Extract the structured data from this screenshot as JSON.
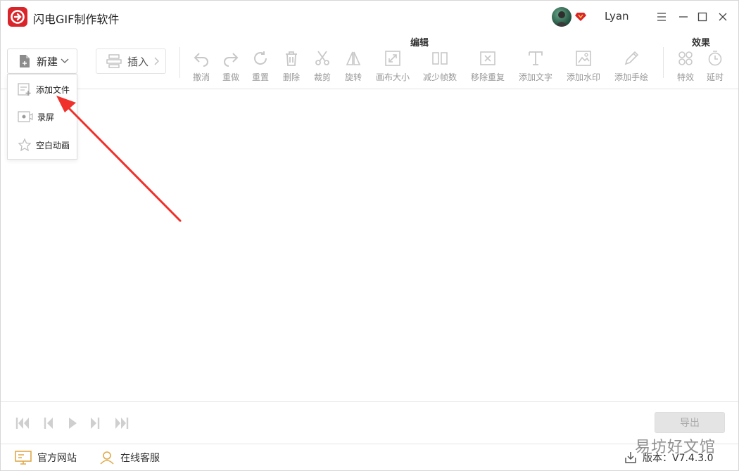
{
  "app": {
    "title": "闪电GIF制作软件",
    "username": "Lyan",
    "brand_color": "#d9242a"
  },
  "toolbar": {
    "new_label": "新建",
    "insert_label": "插入",
    "group_edit_label": "编辑",
    "group_effect_label": "效果",
    "tools": [
      {
        "label": "撤消",
        "icon": "undo-icon"
      },
      {
        "label": "重做",
        "icon": "redo-icon"
      },
      {
        "label": "重置",
        "icon": "reset-icon"
      },
      {
        "label": "删除",
        "icon": "delete-icon"
      },
      {
        "label": "裁剪",
        "icon": "scissors-icon"
      },
      {
        "label": "旋转",
        "icon": "rotate-icon"
      },
      {
        "label": "画布大小",
        "icon": "canvas-size-icon"
      },
      {
        "label": "减少帧数",
        "icon": "reduce-frames-icon"
      },
      {
        "label": "移除重复",
        "icon": "remove-duplicate-icon"
      },
      {
        "label": "添加文字",
        "icon": "add-text-icon"
      },
      {
        "label": "添加水印",
        "icon": "add-watermark-icon"
      },
      {
        "label": "添加手绘",
        "icon": "add-drawing-icon"
      },
      {
        "label": "特效",
        "icon": "effects-icon"
      },
      {
        "label": "延时",
        "icon": "delay-icon"
      }
    ]
  },
  "new_menu": {
    "items": [
      {
        "label": "添加文件",
        "icon": "add-file-icon"
      },
      {
        "label": "录屏",
        "icon": "screen-record-icon"
      },
      {
        "label": "空白动画",
        "icon": "blank-animation-icon"
      }
    ]
  },
  "playback": {
    "export_label": "导出"
  },
  "footer": {
    "website_label": "官方网站",
    "support_label": "在线客服",
    "version_label": "版本：V7.4.3.0"
  },
  "watermark": {
    "text": "易坊好文馆"
  },
  "annotation": {
    "arrow_color": "#f0302a"
  }
}
